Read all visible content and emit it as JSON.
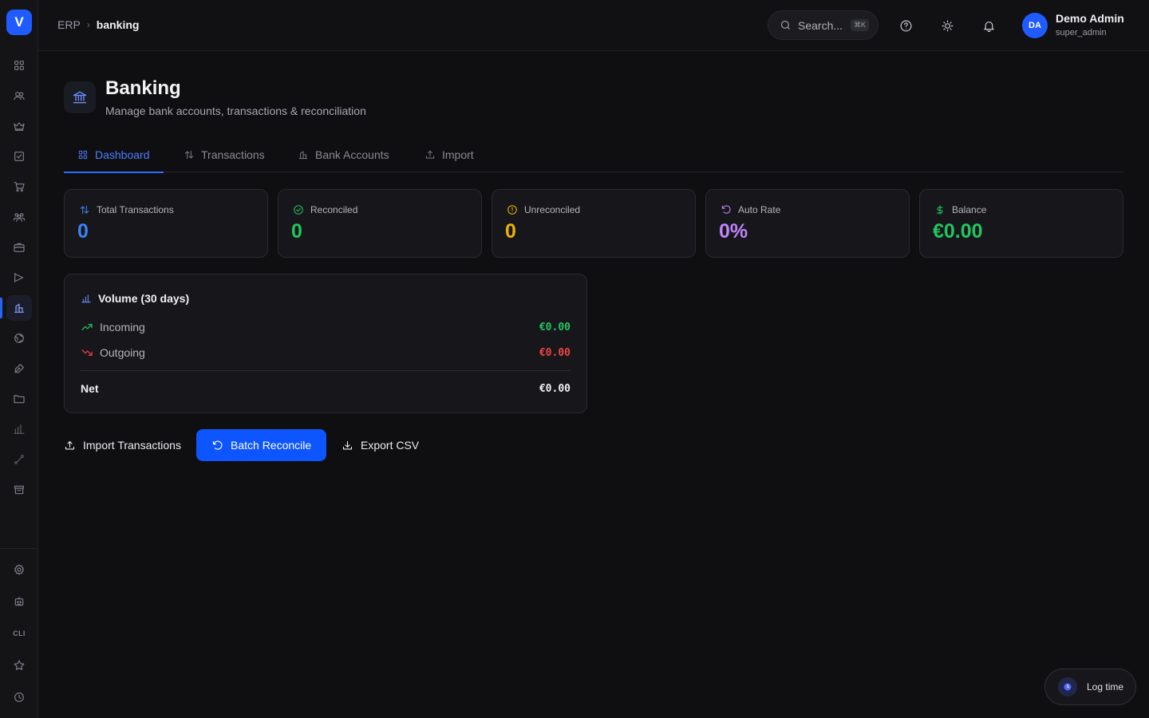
{
  "sidebar": {
    "logo_letter": "V",
    "cli_label": "CLI"
  },
  "header": {
    "breadcrumb_root": "ERP",
    "breadcrumb_current": "banking",
    "search_placeholder": "Search...",
    "search_shortcut": "⌘K",
    "user_initials": "DA",
    "user_name": "Demo Admin",
    "user_role": "super_admin"
  },
  "page": {
    "title": "Banking",
    "subtitle": "Manage bank accounts, transactions & reconciliation"
  },
  "tabs": [
    {
      "label": "Dashboard",
      "icon": "grid-icon",
      "active": true
    },
    {
      "label": "Transactions",
      "icon": "arrows-up-down-icon",
      "active": false
    },
    {
      "label": "Bank Accounts",
      "icon": "building-icon",
      "active": false
    },
    {
      "label": "Import",
      "icon": "upload-icon",
      "active": false
    }
  ],
  "stats": [
    {
      "label": "Total Transactions",
      "value": "0",
      "color": "#3b82f6",
      "icon": "arrows-up-down-icon"
    },
    {
      "label": "Reconciled",
      "value": "0",
      "color": "#22c55e",
      "icon": "check-circle-icon"
    },
    {
      "label": "Unreconciled",
      "value": "0",
      "color": "#eab308",
      "icon": "alert-circle-icon"
    },
    {
      "label": "Auto Rate",
      "value": "0%",
      "color": "#c084fc",
      "icon": "rotate-ccw-icon"
    },
    {
      "label": "Balance",
      "value": "€0.00",
      "color": "#22c55e",
      "icon": "dollar-icon"
    }
  ],
  "volume": {
    "title": "Volume (30 days)",
    "incoming_label": "Incoming",
    "incoming_value": "€0.00",
    "outgoing_label": "Outgoing",
    "outgoing_value": "€0.00",
    "net_label": "Net",
    "net_value": "€0.00",
    "incoming_color": "#22c55e",
    "outgoing_color": "#ef4444"
  },
  "actions": {
    "import_label": "Import Transactions",
    "batch_label": "Batch Reconcile",
    "export_label": "Export CSV"
  },
  "log_time_label": "Log time"
}
